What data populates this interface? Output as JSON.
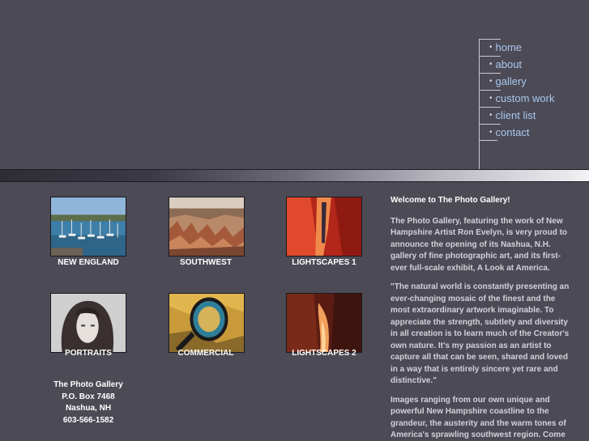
{
  "nav": {
    "items": [
      {
        "label": "home"
      },
      {
        "label": "about"
      },
      {
        "label": "gallery"
      },
      {
        "label": "custom work"
      },
      {
        "label": "client list"
      },
      {
        "label": "contact"
      }
    ],
    "bullet": "•"
  },
  "gallery": {
    "thumbs": [
      {
        "caption": "NEW ENGLAND"
      },
      {
        "caption": "SOUTHWEST"
      },
      {
        "caption": "LIGHTSCAPES 1"
      },
      {
        "caption": "PORTRAITS"
      },
      {
        "caption": "COMMERCIAL"
      },
      {
        "caption": "LIGHTSCAPES 2"
      }
    ]
  },
  "address": {
    "name": "The Photo Gallery",
    "po_box": "P.O. Box 7468",
    "city": "Nashua, NH",
    "phone": "603-566-1582"
  },
  "content": {
    "welcome": "Welcome to The Photo Gallery!",
    "p1": "The Photo Gallery, featuring the work of New Hampshire Artist Ron Evelyn, is very proud to announce the opening of its Nashua, N.H. gallery of fine photographic art, and its first-ever full-scale exhibit, A Look at America.",
    "p2": "\"The natural world is constantly presenting an ever-changing mosaic of the finest and the most extraordinary artwork imaginable. To appreciate the strength, subtlety and diversity in all creation is to learn much of the Creator's own nature. It's my passion as an artist to capture all that can be seen, shared and loved in a way that is entirely sincere yet rare and distinctive.\"",
    "p3": "Images ranging from our own unique and powerful New Hampshire coastline to the grandeur, the austerity and the warm tones of America's sprawling southwest region. Come"
  },
  "colors": {
    "background": "#4c4a55",
    "nav_link": "#a9c8ee",
    "body_text": "#d2d2da",
    "caption_text": "#ffffff"
  }
}
